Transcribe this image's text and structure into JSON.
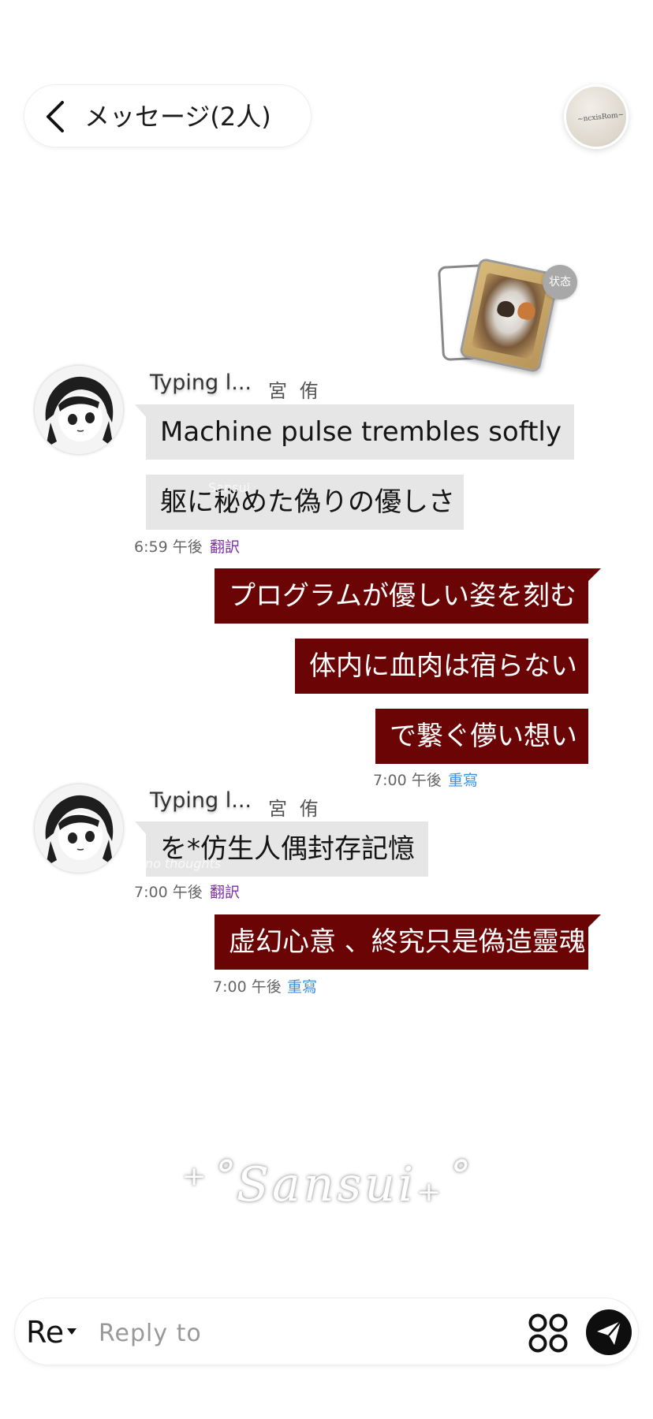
{
  "header": {
    "title": "メッセージ(2人)",
    "avatar_scribble": "~ncxisRom~"
  },
  "status": {
    "badge_label": "状态"
  },
  "messages": {
    "group1": {
      "sender_name": "Typing l...",
      "sender_sub": "宮 侑",
      "bubble1": "Machine pulse trembles softly",
      "bubble2": "躯に秘めた偽りの優しさ",
      "faint_overlay": "Sansui",
      "time": "6:59 午後",
      "action": "翻訳"
    },
    "group2": {
      "bubble1": "プログラムが優しい姿を刻む",
      "bubble2": "体内に血肉は宿らない",
      "bubble3": "で繋ぐ儚い想い",
      "time": "7:00 午後",
      "action": "重寫"
    },
    "group3": {
      "sender_name": "Typing l...",
      "sender_sub": "宮 侑",
      "bubble1": "を*仿生人偶封存記憶",
      "faint_overlay": "no thoughts",
      "time": "7:00 午後",
      "action": "翻訳"
    },
    "group4": {
      "bubble1": "虚幻心意 、終究只是偽造靈魂",
      "time": "7:00 午後",
      "action": "重寫"
    }
  },
  "watermark": "⁺˚Sansui₊˚",
  "input": {
    "prefix": "Re",
    "placeholder": "Reply to"
  },
  "colors": {
    "incoming_bubble": "#e6e6e6",
    "outgoing_bubble": "#6b0505",
    "translate_link": "#7b2fa8",
    "rewrite_link": "#3d8fe0"
  }
}
